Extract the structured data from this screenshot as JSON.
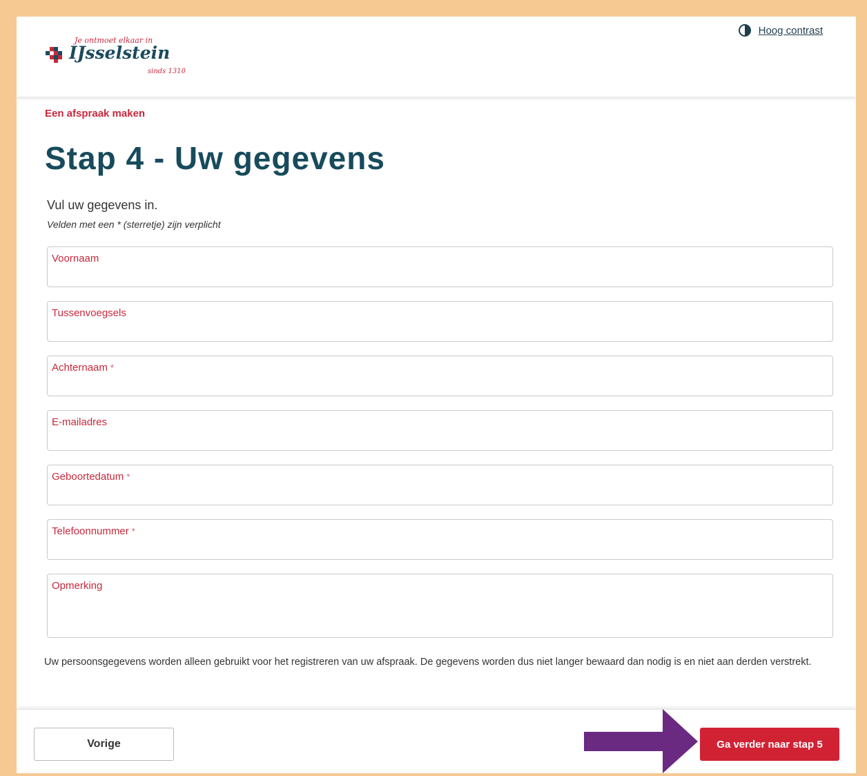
{
  "header": {
    "logo_tagline": "Je ontmoet elkaar in",
    "logo_name": "IJsselstein",
    "logo_since": "sinds 1310",
    "contrast_link": "Hoog contrast"
  },
  "breadcrumb": "Een afspraak maken",
  "title": "Stap 4 - Uw gegevens",
  "intro": "Vul uw gegevens in.",
  "required_note": "Velden met een * (sterretje) zijn verplicht",
  "fields": [
    {
      "label": "Voornaam",
      "required": ""
    },
    {
      "label": "Tussenvoegsels",
      "required": ""
    },
    {
      "label": "Achternaam",
      "required": "*"
    },
    {
      "label": "E-mailadres",
      "required": ""
    },
    {
      "label": "Geboortedatum",
      "required": "*"
    },
    {
      "label": "Telefoonnummer",
      "required": "*"
    },
    {
      "label": "Opmerking",
      "required": ""
    }
  ],
  "privacy_text": "Uw persoonsgegevens worden alleen gebruikt voor het registreren van uw afspraak. De gegevens worden dus niet langer bewaard dan nodig is en niet aan derden verstrekt.",
  "footer": {
    "prev_label": "Vorige",
    "next_label": "Ga verder naar stap 5"
  },
  "colors": {
    "page_border": "#f6c993",
    "accent_red": "#d12234",
    "title_teal": "#174b5c",
    "annotation_arrow": "#6a2a82"
  }
}
